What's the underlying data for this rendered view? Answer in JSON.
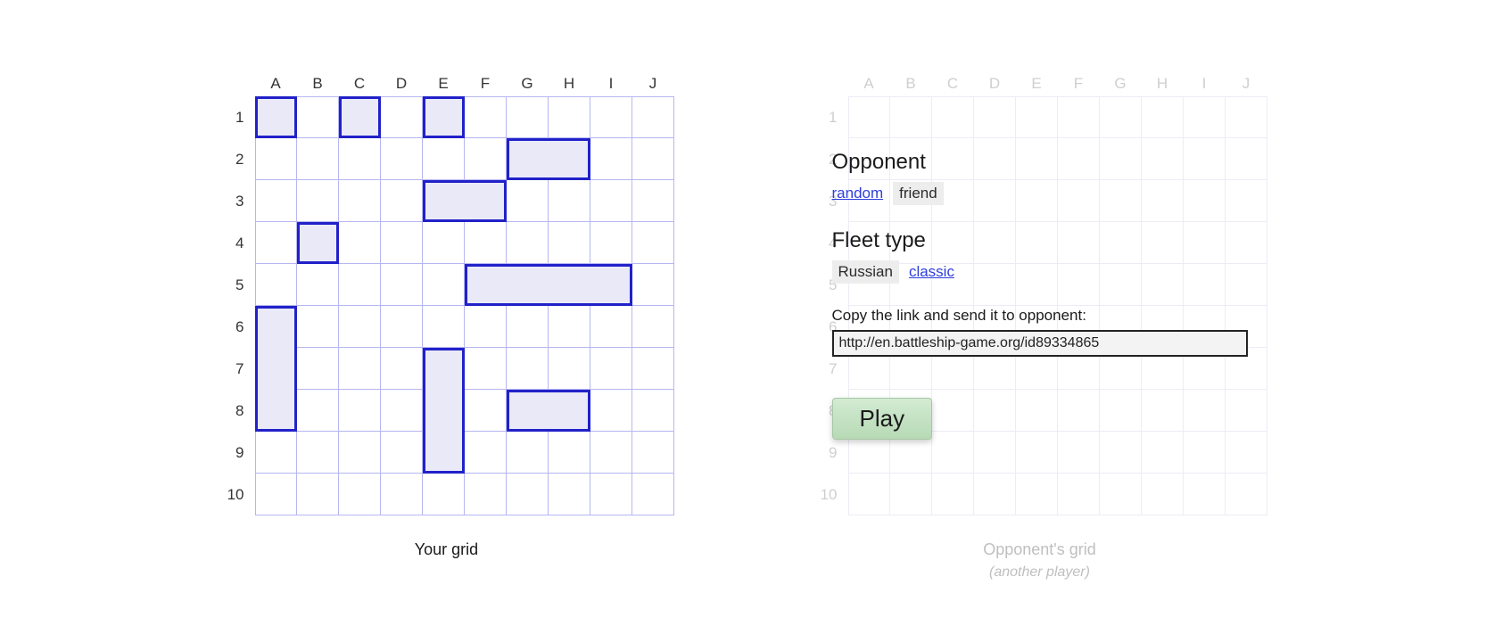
{
  "grid": {
    "columns": [
      "A",
      "B",
      "C",
      "D",
      "E",
      "F",
      "G",
      "H",
      "I",
      "J"
    ],
    "rows": [
      "1",
      "2",
      "3",
      "4",
      "5",
      "6",
      "7",
      "8",
      "9",
      "10"
    ],
    "size": 10
  },
  "captions": {
    "your_grid": "Your grid",
    "opponent_grid": "Opponent's grid",
    "opponent_sub": "(another player)"
  },
  "ships": [
    {
      "col": 0,
      "row": 0,
      "w": 1,
      "h": 1
    },
    {
      "col": 2,
      "row": 0,
      "w": 1,
      "h": 1
    },
    {
      "col": 4,
      "row": 0,
      "w": 1,
      "h": 1
    },
    {
      "col": 6,
      "row": 1,
      "w": 2,
      "h": 1
    },
    {
      "col": 4,
      "row": 2,
      "w": 2,
      "h": 1
    },
    {
      "col": 1,
      "row": 3,
      "w": 1,
      "h": 1
    },
    {
      "col": 5,
      "row": 4,
      "w": 4,
      "h": 1
    },
    {
      "col": 0,
      "row": 5,
      "w": 1,
      "h": 3
    },
    {
      "col": 4,
      "row": 6,
      "w": 1,
      "h": 3
    },
    {
      "col": 6,
      "row": 7,
      "w": 2,
      "h": 1
    }
  ],
  "opponent_panel": {
    "title": "Opponent",
    "options": [
      "random",
      "friend"
    ],
    "selected": "friend",
    "fleet_title": "Fleet type",
    "fleet_options": [
      "Russian",
      "classic"
    ],
    "fleet_selected": "Russian",
    "copy_label": "Copy the link and send it to opponent:",
    "game_url": "http://en.battleship-game.org/id89334865",
    "play_label": "Play"
  }
}
